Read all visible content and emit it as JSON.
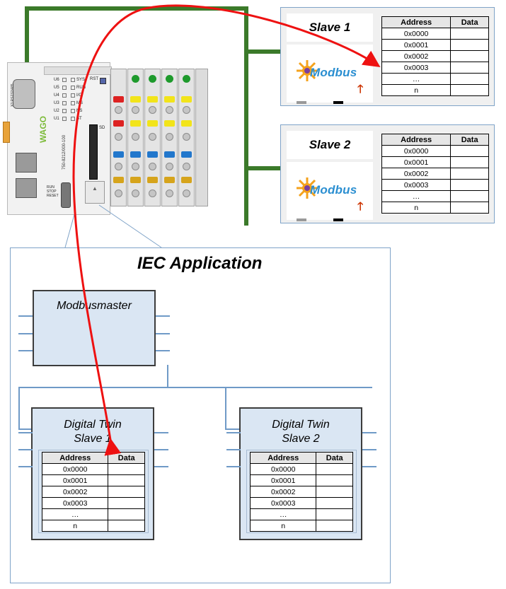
{
  "slave1": {
    "title": "Slave 1",
    "logo_text": "Modbus"
  },
  "slave2": {
    "title": "Slave 2",
    "logo_text": "Modbus"
  },
  "register_table": {
    "header_address": "Address",
    "header_data": "Data",
    "rows": [
      "0x0000",
      "0x0001",
      "0x0002",
      "0x0003",
      "…",
      "n"
    ]
  },
  "iec": {
    "title": "IEC Application",
    "modbusmaster": "Modbusmaster",
    "twin1_line1": "Digital Twin",
    "twin1_line2": "Slave 1",
    "twin2_line1": "Digital Twin",
    "twin2_line2": "Slave 2"
  },
  "controller": {
    "brand": "WAGO",
    "model": "750-8212/000-100",
    "port_label": "X3 RS232/485",
    "sd_label": "SD",
    "rst_label": "RST",
    "switch_label": "RUN STOP RESET",
    "led_left": [
      "U6",
      "U5",
      "U4",
      "U3",
      "U2",
      "U1"
    ],
    "led_right": [
      "SYS",
      "RUN",
      "I/O",
      "MS",
      "NS",
      "BT"
    ],
    "port_labels": "ACT X1 LNK ACT X2 LNK"
  },
  "colors": {
    "network_green": "#3b7a2a",
    "arrow_red": "#ee1111",
    "panel_border": "#7fa3c8",
    "bus_blue": "#6f9ac7",
    "block_fill": "#dae6f3",
    "modbus_blue": "#2b8fd1"
  }
}
